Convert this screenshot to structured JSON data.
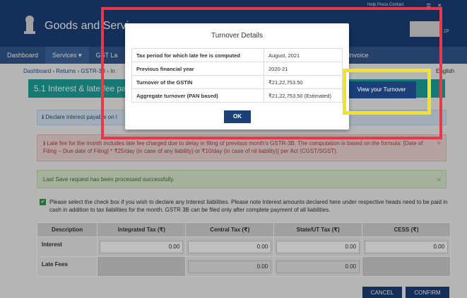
{
  "header": {
    "portal_title": "Goods and Servi",
    "top_links": "Help  Press Contact",
    "top_icons": "⚿ ✕",
    "user_tag": "ZP"
  },
  "nav": {
    "items": [
      "Dashboard",
      "Services ▾",
      "GST La",
      "",
      "",
      "",
      "",
      ""
    ],
    "invoice": "Invoice"
  },
  "breadcrumb": {
    "items": [
      "Dashboard",
      "Returns",
      "GSTR-3B",
      "In"
    ],
    "separator": " › ",
    "language": "English"
  },
  "section": {
    "title": "5.1 Interest & late fee pay"
  },
  "info_box": {
    "text": "ℹ Declare interest payable on l"
  },
  "late_fee_alert": {
    "text": "ℹ Late fee for the month includes late fee charged due to delay in filing of previous month's GSTR-3B. The computation is based on the formula: [Date of Filing – Due date of Filing] * ₹25/day (in case of any liability) or ₹10/day (in case of nil liability)] per Act (CGST/SGST).",
    "close": "✕"
  },
  "success_alert": {
    "text": "Last Save request has been processed successfully.",
    "close": "✕"
  },
  "declaration": {
    "checkbox_mark": "✔",
    "text": "Please select the check box if you wish to declare any Interest liabilities. Please note Interest amounts declared here under respective heads need to be paid in cash in addition to tax liabilities for the month. GSTR 3B can be filed only after complete payment of all liabilities."
  },
  "liability_table": {
    "columns": [
      "Description",
      "Integrated Tax (₹)",
      "Central Tax (₹)",
      "State/UT Tax (₹)",
      "CESS (₹)"
    ],
    "rows": [
      {
        "label": "Interest",
        "values": [
          "0.00",
          "0.00",
          "0.00",
          "0.00"
        ]
      },
      {
        "label": "Late Fees",
        "values": [
          "",
          "0.00",
          "0.00",
          ""
        ]
      }
    ]
  },
  "actions": {
    "cancel": "CANCEL",
    "confirm": "CONFIRM",
    "view_turnover": "View your Turnover"
  },
  "modal": {
    "title": "Turnover Details",
    "rows": [
      {
        "label": "Tax period for which late fee is computed",
        "value": "August, 2021"
      },
      {
        "label": "Previous financial year",
        "value": "2020-21"
      },
      {
        "label": "Turnover of the GSTIN",
        "value": "₹21,22,753.50"
      },
      {
        "label": "Aggregate turnover (PAN based)",
        "value": "₹21,22,753.50 (Estimated)"
      }
    ],
    "ok": "OK"
  },
  "colors": {
    "header": "#1b3f78",
    "nav": "#30578e",
    "section_bar": "#1ba39a",
    "highlight_red": "#e63a4a",
    "highlight_yellow": "#f3e22a"
  }
}
